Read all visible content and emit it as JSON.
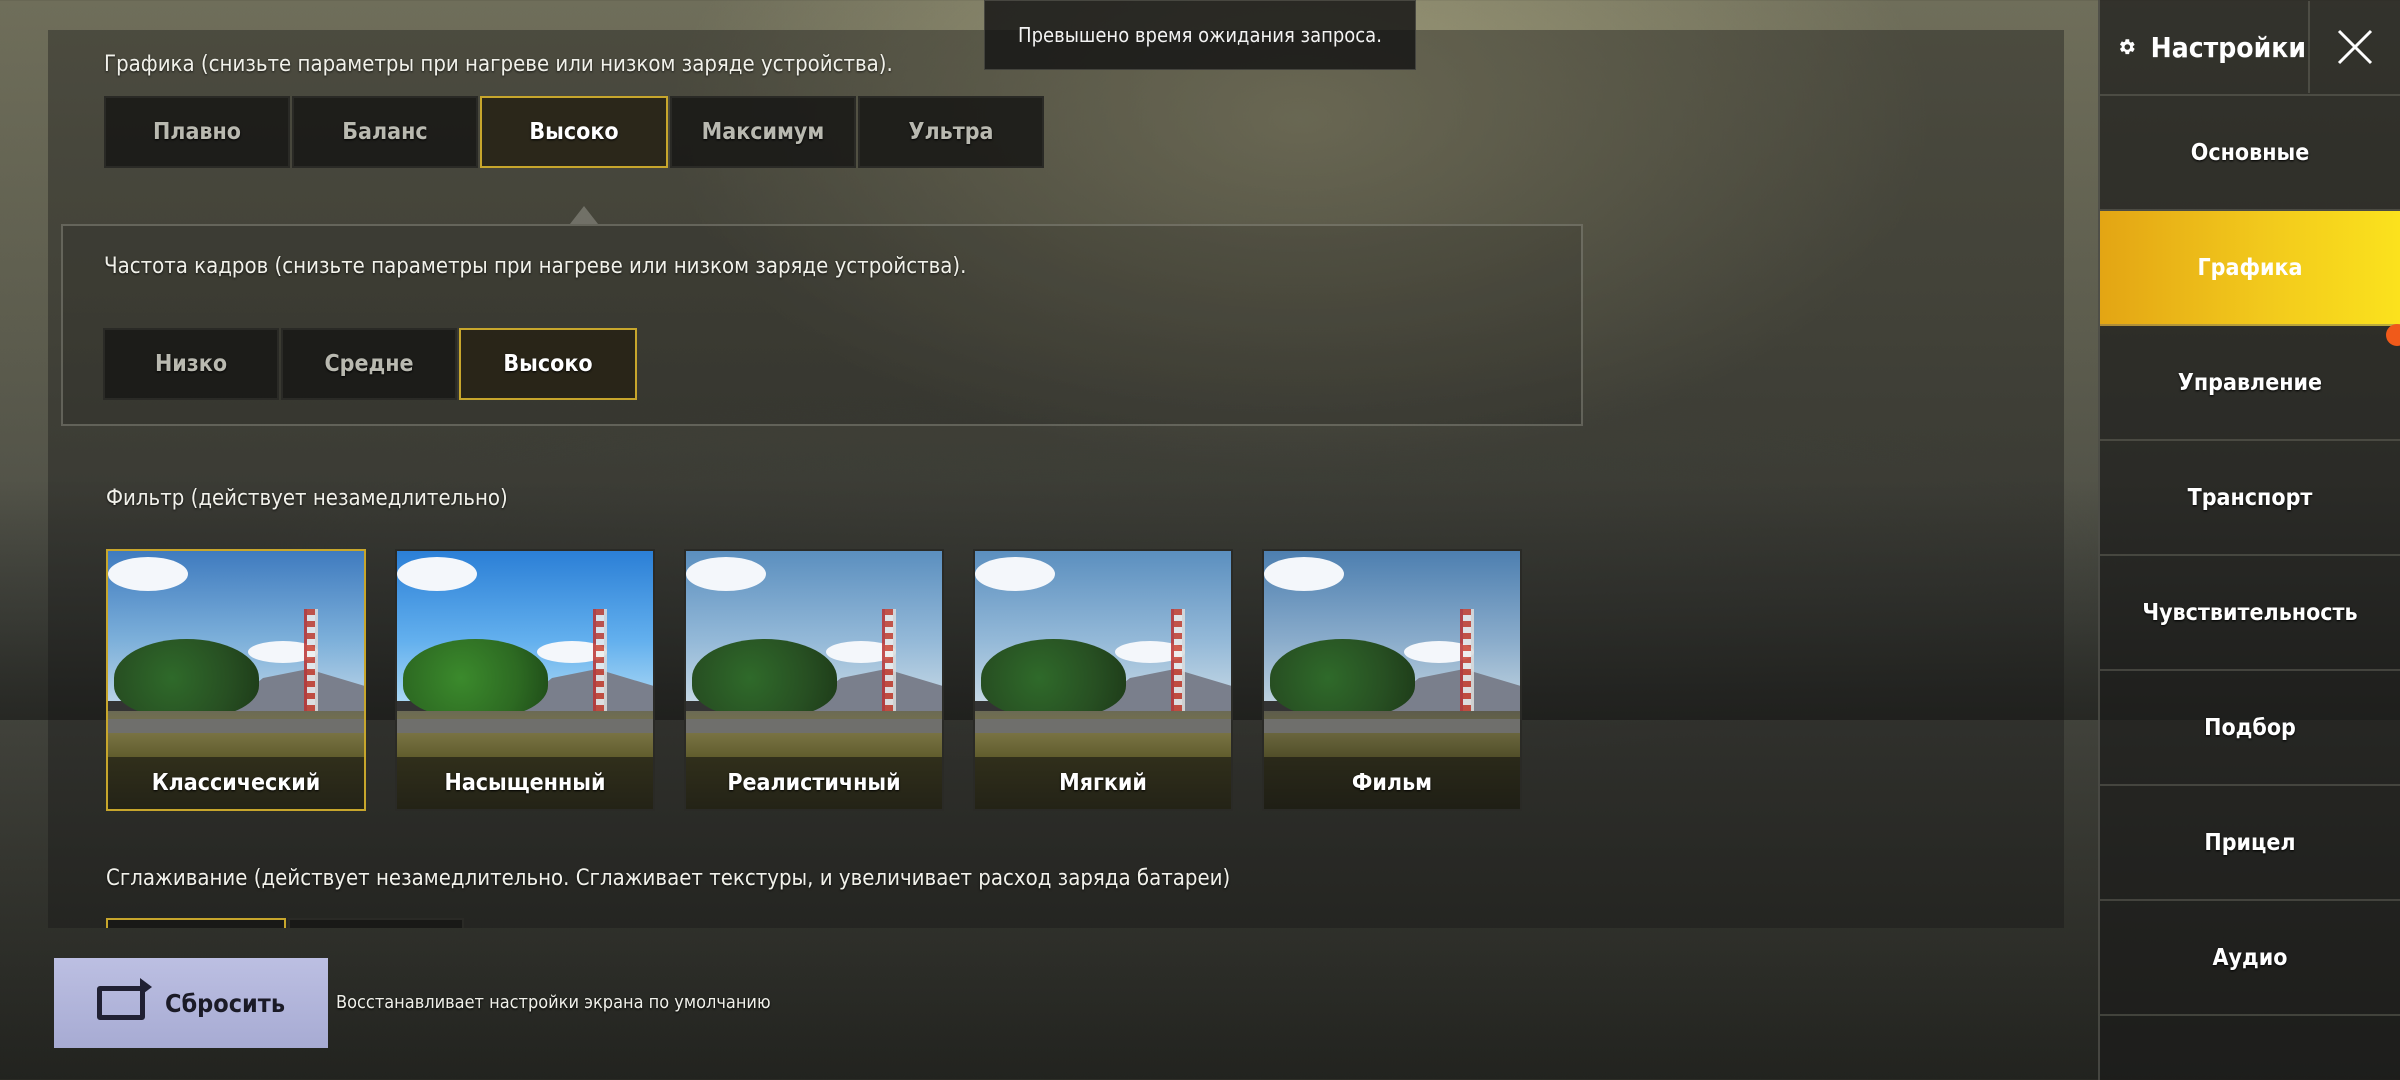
{
  "toast": {
    "text": "Превышено время ожидания запроса."
  },
  "graphics": {
    "label": "Графика (снизьте параметры при нагреве или низком заряде устройства).",
    "options": [
      "Плавно",
      "Баланс",
      "Высоко",
      "Максимум",
      "Ультра"
    ],
    "selected": "Высоко"
  },
  "framerate": {
    "label": "Частота кадров (снизьте параметры при нагреве или низком заряде устройства).",
    "options": [
      "Низко",
      "Средне",
      "Высоко"
    ],
    "selected": "Высоко"
  },
  "filter": {
    "label": "Фильтр (действует незамедлительно)",
    "options": [
      "Классический",
      "Насыщенный",
      "Реалистичный",
      "Мягкий",
      "Фильм"
    ],
    "selected": "Классический"
  },
  "antialiasing": {
    "label": "Сглаживание (действует незамедлительно. Сглаживает текстуры, и увеличивает расход заряда батареи)"
  },
  "reset": {
    "label": "Сбросить",
    "hint": "Восстанавливает настройки экрана по умолчанию"
  },
  "sidebar": {
    "title": "Настройки",
    "items": [
      {
        "label": "Основные"
      },
      {
        "label": "Графика",
        "active": true
      },
      {
        "label": "Управление"
      },
      {
        "label": "Транспорт"
      },
      {
        "label": "Чувствительность"
      },
      {
        "label": "Подбор"
      },
      {
        "label": "Прицел"
      },
      {
        "label": "Аудио"
      }
    ]
  },
  "colors": {
    "accent_gold": "#c7a62c",
    "active_tab": "#f2c91c",
    "notify_dot": "#f05a1a",
    "reset_button": "#b2b5dc"
  }
}
